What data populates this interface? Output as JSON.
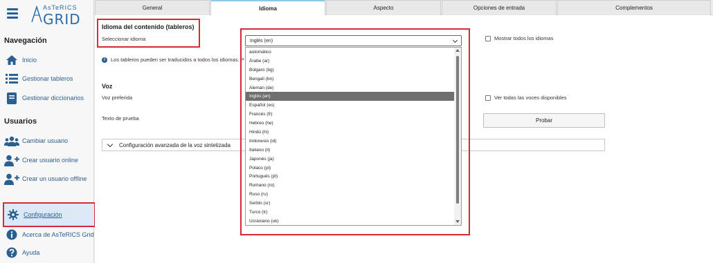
{
  "logo": {
    "small": "AsTeRICS",
    "big": "GRID"
  },
  "sidebar": {
    "nav_title": "Navegación",
    "users_title": "Usuarios",
    "items": [
      {
        "label": "Inicio",
        "icon": "home-icon"
      },
      {
        "label": "Gestionar tableros",
        "icon": "list-icon"
      },
      {
        "label": "Gestionar diccionarios",
        "icon": "dictionary-icon"
      },
      {
        "label": "Cambiar usuario",
        "icon": "users-icon"
      },
      {
        "label": "Crear usuario online",
        "icon": "user-plus-icon"
      },
      {
        "label": "Crear un usuario offline",
        "icon": "user-plus-icon"
      },
      {
        "label": "Configuración",
        "icon": "gear-icon"
      },
      {
        "label": "Acerca de AsTeRICS Grid",
        "icon": "info-icon"
      },
      {
        "label": "Ayuda",
        "icon": "help-icon"
      }
    ]
  },
  "tabs": [
    "General",
    "Idioma",
    "Aspecto",
    "Opciones de entrada",
    "Complementos"
  ],
  "language": {
    "title": "Idioma del contenido (tableros)",
    "select_label": "Seleccionar idioma",
    "selected": "Inglés (en)",
    "show_all": "Mostrar todos los idiomas",
    "info": "Los tableros pueden ser traducidos a todos los idiomas. P"
  },
  "dropdown_options": [
    "automático",
    "Árabe (ar)",
    "Búlgaro (bg)",
    "Bengalí (bn)",
    "Alemán (de)",
    "Inglés (en)",
    "Español (es)",
    "Francés (fr)",
    "Hebreo (he)",
    "Hindú (hi)",
    "Indonesio (id)",
    "Italiano (it)",
    "Japonés (ja)",
    "Polaco (pl)",
    "Portugués (pt)",
    "Rumano (ro)",
    "Ruso (ru)",
    "Serbio (sr)",
    "Turco (tr)",
    "Ucraniano (uk)"
  ],
  "voice": {
    "title": "Voz",
    "preferred": "Voz preferida",
    "show_all": "Ver todas las voces disponibles",
    "test_text": "Texto de prueba",
    "test_button": "Probar",
    "advanced": "Configuración avanzada de la voz sintetizada"
  },
  "colors": {
    "accent": "#2b5e91",
    "highlight": "#d42a35",
    "active_nav": "#dbe9f6"
  }
}
